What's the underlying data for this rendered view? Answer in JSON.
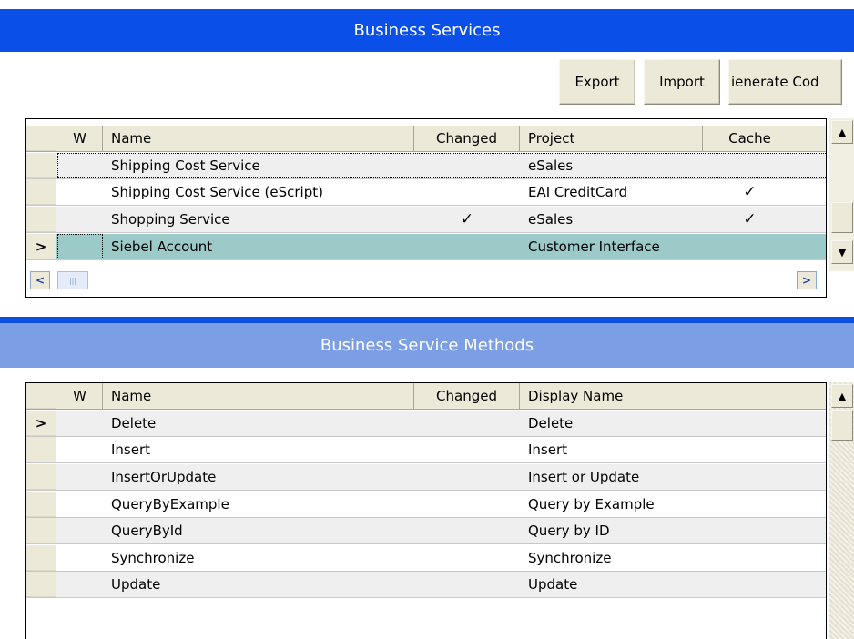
{
  "top": {
    "title": "Business Services",
    "buttons": {
      "export": "Export",
      "import": "Import",
      "generate": "ienerate Cod"
    },
    "columns": {
      "w": "W",
      "name": "Name",
      "changed": "Changed",
      "project": "Project",
      "cache": "Cache"
    },
    "rows": [
      {
        "name": "Shipping Cost Service",
        "changed": "",
        "project": "eSales",
        "cache": ""
      },
      {
        "name": "Shipping Cost Service (eScript)",
        "changed": "",
        "project": "EAI CreditCard",
        "cache": "✓"
      },
      {
        "name": "Shopping Service",
        "changed": "✓",
        "project": "eSales",
        "cache": "✓"
      },
      {
        "name": "Siebel Account",
        "changed": "",
        "project": "Customer Interface",
        "cache": ""
      }
    ],
    "selected_marker": ">"
  },
  "bottom": {
    "title": "Business Service Methods",
    "columns": {
      "w": "W",
      "name": "Name",
      "changed": "Changed",
      "display": "Display Name"
    },
    "rows": [
      {
        "name": "Delete",
        "display": "Delete"
      },
      {
        "name": "Insert",
        "display": "Insert"
      },
      {
        "name": "InsertOrUpdate",
        "display": "Insert or Update"
      },
      {
        "name": "QueryByExample",
        "display": "Query by Example"
      },
      {
        "name": "QueryById",
        "display": "Query by ID"
      },
      {
        "name": "Synchronize",
        "display": "Synchronize"
      },
      {
        "name": "Update",
        "display": "Update"
      }
    ],
    "selected_marker": ">"
  },
  "icons": {
    "scroll_up": "▲",
    "scroll_down": "▼",
    "scroll_left": "<",
    "scroll_right": ">",
    "thumb_grip": "|||"
  },
  "colors": {
    "active_title": "#0a50e8",
    "inactive_title": "#7b9ee4",
    "selected_row": "#9bcac8",
    "alt_row": "#efefef"
  }
}
